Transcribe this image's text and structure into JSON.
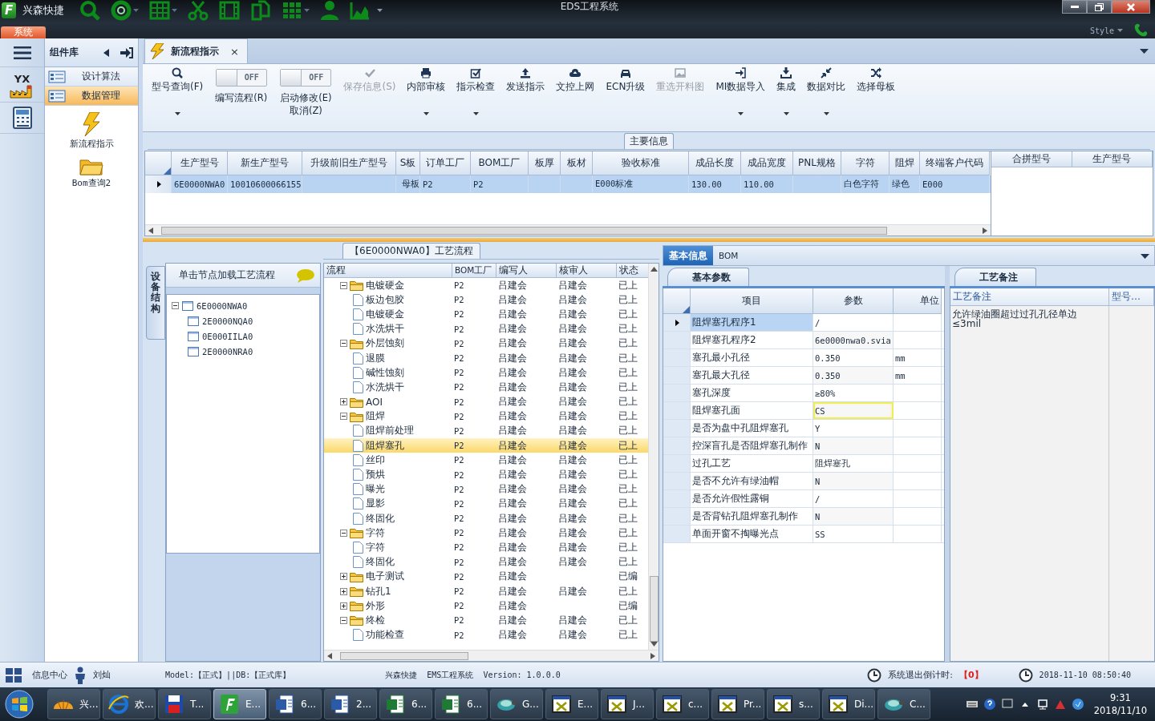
{
  "window": {
    "logo": "F",
    "app_name": "兴森快捷",
    "title": "EDS工程系统",
    "style_label": "Style"
  },
  "system_tab": {
    "label": "系统",
    "selected": true
  },
  "left_strip": {
    "badge": "YX"
  },
  "component_panel": {
    "title": "组件库",
    "items": [
      {
        "label": "设计算法",
        "selected": false
      },
      {
        "label": "数据管理",
        "selected": true
      }
    ],
    "shortcuts": [
      {
        "label": "新流程指示"
      },
      {
        "label": "Bom查询2"
      }
    ]
  },
  "doc_tabs": [
    {
      "label": "新流程指示",
      "selected": true,
      "close": "×"
    }
  ],
  "ribbon": [
    {
      "kind": "button",
      "label": "型号查询(F)",
      "dropdown": true,
      "disabled": false
    },
    {
      "kind": "toggle",
      "label": "编写流程(R)",
      "state_text": "OFF",
      "on": false
    },
    {
      "kind": "toggle",
      "label": "启动修改(E)\n取消(Z)",
      "state_text": "OFF",
      "on": false
    },
    {
      "kind": "button",
      "label": "保存信息(S)",
      "dropdown": false,
      "disabled": true
    },
    {
      "kind": "button",
      "label": "内部审核",
      "dropdown": true,
      "disabled": false
    },
    {
      "kind": "button",
      "label": "指示检查",
      "dropdown": true,
      "disabled": false
    },
    {
      "kind": "button",
      "label": "发送指示",
      "dropdown": false,
      "disabled": false
    },
    {
      "kind": "button",
      "label": "文控上网",
      "dropdown": false,
      "disabled": false
    },
    {
      "kind": "button",
      "label": "ECN升级",
      "dropdown": false,
      "disabled": false
    },
    {
      "kind": "button",
      "label": "重选开料图",
      "dropdown": false,
      "disabled": true
    },
    {
      "kind": "button",
      "label": "MI数据导入",
      "dropdown": true,
      "disabled": false
    },
    {
      "kind": "button",
      "label": "集成",
      "dropdown": true,
      "disabled": false
    },
    {
      "kind": "button",
      "label": "数据对比",
      "dropdown": true,
      "disabled": false
    },
    {
      "kind": "button",
      "label": "选择母板",
      "dropdown": false,
      "disabled": false
    }
  ],
  "main_info": {
    "title": "主要信息",
    "columns": [
      "生产型号",
      "新生产型号",
      "升级前旧生产型号",
      "S板",
      "订单工厂",
      "BOM工厂",
      "板厚",
      "板材",
      "验收标准",
      "成品长度",
      "成品宽度",
      "PNL规格",
      "字符",
      "阻焊",
      "终端客户代码"
    ],
    "rows": [
      {
        "selected": true,
        "cells": [
          "6E0000NWA0",
          "10010600066155",
          null,
          "母板",
          "P2",
          "P2",
          null,
          null,
          "E000标准",
          "130.00",
          "110.00",
          null,
          "白色字符",
          "绿色",
          "E000"
        ]
      }
    ],
    "side_columns": [
      "合拼型号",
      "生产型号"
    ]
  },
  "device_structure": {
    "tab": "设备结构",
    "hint": "单击节点加载工艺流程",
    "tree": [
      {
        "label": "6E0000NWA0",
        "expanded": true,
        "children": [
          {
            "label": "2E0000NQA0"
          },
          {
            "label": "0E000IILA0"
          },
          {
            "label": "2E0000NRA0"
          }
        ]
      }
    ]
  },
  "process_flow": {
    "title": "【6E0000NWA0】工艺流程",
    "columns": [
      "流程",
      "BOM工厂",
      "编写人",
      "核审人",
      "状态"
    ],
    "rows": [
      {
        "kind": "folder",
        "name": "电镀硬金",
        "bom_factory": "P2",
        "writer": "吕建会",
        "reviewer": "吕建会",
        "status": "已上",
        "selected": false,
        "expanded": true,
        "children": [
          {
            "kind": "step",
            "name": "板边包胶",
            "bom_factory": "P2",
            "writer": "吕建会",
            "reviewer": "吕建会",
            "status": "已上",
            "selected": false
          },
          {
            "kind": "step",
            "name": "电镀硬金",
            "bom_factory": "P2",
            "writer": "吕建会",
            "reviewer": "吕建会",
            "status": "已上",
            "selected": false
          },
          {
            "kind": "step",
            "name": "水洗烘干",
            "bom_factory": "P2",
            "writer": "吕建会",
            "reviewer": "吕建会",
            "status": "已上",
            "selected": false
          }
        ]
      },
      {
        "kind": "folder",
        "name": "外层蚀刻",
        "bom_factory": "P2",
        "writer": "吕建会",
        "reviewer": "吕建会",
        "status": "已上",
        "selected": false,
        "expanded": true,
        "children": [
          {
            "kind": "step",
            "name": "退膜",
            "bom_factory": "P2",
            "writer": "吕建会",
            "reviewer": "吕建会",
            "status": "已上",
            "selected": false
          },
          {
            "kind": "step",
            "name": "碱性蚀刻",
            "bom_factory": "P2",
            "writer": "吕建会",
            "reviewer": "吕建会",
            "status": "已上",
            "selected": false
          },
          {
            "kind": "step",
            "name": "水洗烘干",
            "bom_factory": "P2",
            "writer": "吕建会",
            "reviewer": "吕建会",
            "status": "已上",
            "selected": false
          }
        ]
      },
      {
        "kind": "folder",
        "name": "AOI",
        "bom_factory": "P2",
        "writer": "吕建会",
        "reviewer": "吕建会",
        "status": "已上",
        "selected": false,
        "expanded": false
      },
      {
        "kind": "folder",
        "name": "阻焊",
        "bom_factory": "P2",
        "writer": "吕建会",
        "reviewer": "吕建会",
        "status": "已上",
        "selected": false,
        "expanded": true,
        "children": [
          {
            "kind": "step",
            "name": "阻焊前处理",
            "bom_factory": "P2",
            "writer": "吕建会",
            "reviewer": "吕建会",
            "status": "已上",
            "selected": false
          },
          {
            "kind": "step",
            "name": "阻焊塞孔",
            "bom_factory": "P2",
            "writer": "吕建会",
            "reviewer": "吕建会",
            "status": "已上",
            "selected": true
          },
          {
            "kind": "step",
            "name": "丝印",
            "bom_factory": "P2",
            "writer": "吕建会",
            "reviewer": "吕建会",
            "status": "已上",
            "selected": false
          },
          {
            "kind": "step",
            "name": "预烘",
            "bom_factory": "P2",
            "writer": "吕建会",
            "reviewer": "吕建会",
            "status": "已上",
            "selected": false
          },
          {
            "kind": "step",
            "name": "曝光",
            "bom_factory": "P2",
            "writer": "吕建会",
            "reviewer": "吕建会",
            "status": "已上",
            "selected": false
          },
          {
            "kind": "step",
            "name": "显影",
            "bom_factory": "P2",
            "writer": "吕建会",
            "reviewer": "吕建会",
            "status": "已上",
            "selected": false
          },
          {
            "kind": "step",
            "name": "终固化",
            "bom_factory": "P2",
            "writer": "吕建会",
            "reviewer": "吕建会",
            "status": "已上",
            "selected": false
          }
        ]
      },
      {
        "kind": "folder",
        "name": "字符",
        "bom_factory": "P2",
        "writer": "吕建会",
        "reviewer": "吕建会",
        "status": "已上",
        "selected": false,
        "expanded": true,
        "children": [
          {
            "kind": "step",
            "name": "字符",
            "bom_factory": "P2",
            "writer": "吕建会",
            "reviewer": "吕建会",
            "status": "已上",
            "selected": false
          },
          {
            "kind": "step",
            "name": "终固化",
            "bom_factory": "P2",
            "writer": "吕建会",
            "reviewer": "吕建会",
            "status": "已上",
            "selected": false
          }
        ]
      },
      {
        "kind": "folder",
        "name": "电子测试",
        "bom_factory": "P2",
        "writer": "吕建会",
        "status": "已编",
        "selected": false,
        "expanded": false
      },
      {
        "kind": "folder",
        "name": "钻孔1",
        "bom_factory": "P2",
        "writer": "吕建会",
        "reviewer": "吕建会",
        "status": "已上",
        "selected": false,
        "expanded": false
      },
      {
        "kind": "folder",
        "name": "外形",
        "bom_factory": "P2",
        "writer": "吕建会",
        "status": "已编",
        "selected": false,
        "expanded": false
      },
      {
        "kind": "folder",
        "name": "终检",
        "bom_factory": "P2",
        "writer": "吕建会",
        "reviewer": "吕建会",
        "status": "已上",
        "selected": false,
        "expanded": true,
        "children": [
          {
            "kind": "step",
            "name": "功能检查",
            "bom_factory": "P2",
            "writer": "吕建会",
            "reviewer": "吕建会",
            "status": "已上",
            "selected": false
          }
        ]
      }
    ]
  },
  "detail_tabs": [
    {
      "label": "基本信息",
      "selected": true
    },
    {
      "label": "BOM",
      "selected": false
    }
  ],
  "basic_params": {
    "title": "基本参数",
    "columns": [
      "项目",
      "参数",
      "单位"
    ],
    "rows": [
      {
        "item": "阻焊塞孔程序1",
        "value": "/",
        "selected": true,
        "focused": false
      },
      {
        "item": "阻焊塞孔程序2",
        "value": "6e0000nwa0.svia",
        "selected": false,
        "focused": false
      },
      {
        "item": "塞孔最小孔径",
        "value": "0.350",
        "unit": "mm",
        "selected": false,
        "focused": false
      },
      {
        "item": "塞孔最大孔径",
        "value": "0.350",
        "unit": "mm",
        "selected": false,
        "focused": false
      },
      {
        "item": "塞孔深度",
        "value": "≥80%",
        "selected": false,
        "focused": false
      },
      {
        "item": "阻焊塞孔面",
        "value": "CS",
        "selected": false,
        "focused": true
      },
      {
        "item": "是否为盘中孔阻焊塞孔",
        "value": "Y",
        "selected": false,
        "focused": false
      },
      {
        "item": "控深盲孔是否阻焊塞孔制作",
        "value": "N",
        "selected": false,
        "focused": false
      },
      {
        "item": "过孔工艺",
        "value": "阻焊塞孔",
        "selected": false,
        "focused": false
      },
      {
        "item": "是否不允许有绿油帽",
        "value": "N",
        "selected": false,
        "focused": false
      },
      {
        "item": "是否允许假性露铜",
        "value": "/",
        "selected": false,
        "focused": false
      },
      {
        "item": "是否背钻孔阻焊塞孔制作",
        "value": "N",
        "selected": false,
        "focused": false
      },
      {
        "item": "单面开窗不掏曝光点",
        "value": "SS",
        "selected": false,
        "focused": false
      }
    ]
  },
  "process_notes": {
    "title": "工艺备注",
    "columns": [
      "工艺备注",
      "型号…"
    ],
    "text": "允许绿油圈超过过孔孔径单边\n≤3mil"
  },
  "status_bar": {
    "info_center": "信息中心",
    "user": "刘灿",
    "model": "Model:【正式】||DB:【正式库】",
    "product": "兴森快捷  EMS工程系统  Version: 1.0.0.0",
    "countdown_label": "系统退出倒计时:",
    "countdown_value": "【0】",
    "datetime": "2018-11-10 08:50:40"
  },
  "taskbar": {
    "items": [
      {
        "label": "兴...",
        "selected": false
      },
      {
        "label": "欢...",
        "selected": false
      },
      {
        "label": "T...",
        "selected": false
      },
      {
        "label": "E...",
        "selected": true
      },
      {
        "label": "6...",
        "selected": false
      },
      {
        "label": "2...",
        "selected": false
      },
      {
        "label": "6...",
        "selected": false
      },
      {
        "label": "6...",
        "selected": false
      },
      {
        "label": "G...",
        "selected": false
      },
      {
        "label": "E...",
        "selected": false
      },
      {
        "label": "J...",
        "selected": false
      },
      {
        "label": "c...",
        "selected": false
      },
      {
        "label": "Pr...",
        "selected": false
      },
      {
        "label": "s...",
        "selected": false
      },
      {
        "label": "Di...",
        "selected": false
      },
      {
        "label": "C...",
        "selected": false
      }
    ],
    "time": "9:31",
    "date": "2018/11/10"
  }
}
